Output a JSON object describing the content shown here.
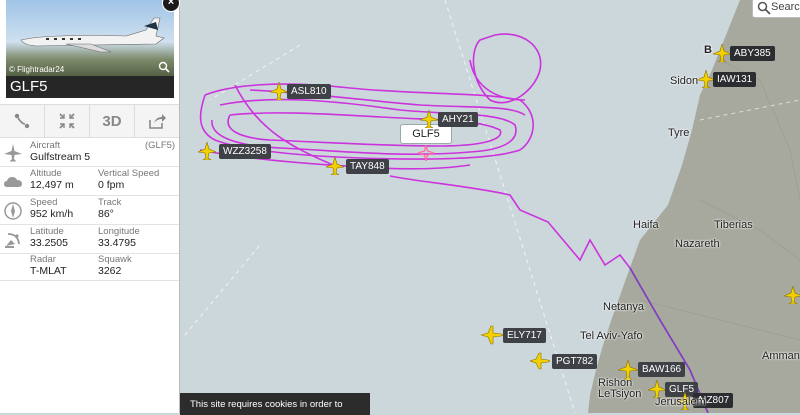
{
  "search": {
    "placeholder": "Search"
  },
  "cookie": {
    "text": "This site requires cookies in order to"
  },
  "selected_flight_label": "GLF5",
  "planes": [
    {
      "callsign": "ASL810"
    },
    {
      "callsign": "AHY21"
    },
    {
      "callsign": "WZZ3258"
    },
    {
      "callsign": "TAY848"
    },
    {
      "callsign": "ABY385"
    },
    {
      "callsign": "IAW131"
    },
    {
      "callsign": "ELY717"
    },
    {
      "callsign": "PGT782"
    },
    {
      "callsign": "BAW166"
    },
    {
      "callsign": "GLF5"
    },
    {
      "callsign": "AIZ807"
    }
  ],
  "cities": {
    "sidon": "Sidon",
    "tyre": "Tyre",
    "haifa": "Haifa",
    "tiberias": "Tiberias",
    "nazareth": "Nazareth",
    "netanya": "Netanya",
    "tel_aviv": "Tel Aviv-Yafo",
    "rishon": "Rishon\nLeTsiyon",
    "jerusalem": "Jerusalem",
    "amman": "Amman",
    "beirut": "B"
  },
  "panel": {
    "photo_credit": "© Flightradar24",
    "callsign": "GLF5",
    "toolbar": {
      "three_d": "3D"
    },
    "aircraft_label": "Aircraft",
    "aircraft_code": "(GLF5)",
    "aircraft_value": "Gulfstream 5",
    "altitude_label": "Altitude",
    "altitude_value": "12,497 m",
    "vspeed_label": "Vertical Speed",
    "vspeed_value": "0 fpm",
    "speed_label": "Speed",
    "speed_value": "952 km/h",
    "track_label": "Track",
    "track_value": "86°",
    "lat_label": "Latitude",
    "lat_value": "33.2505",
    "lon_label": "Longitude",
    "lon_value": "33.4795",
    "radar_label": "Radar",
    "radar_value": "T-MLAT",
    "squawk_label": "Squawk",
    "squawk_value": "3262"
  },
  "colors": {
    "sea": "#ccd7dc",
    "land": "#a8a9a0",
    "track": "#cc33dd",
    "plane": "#f3d000"
  }
}
